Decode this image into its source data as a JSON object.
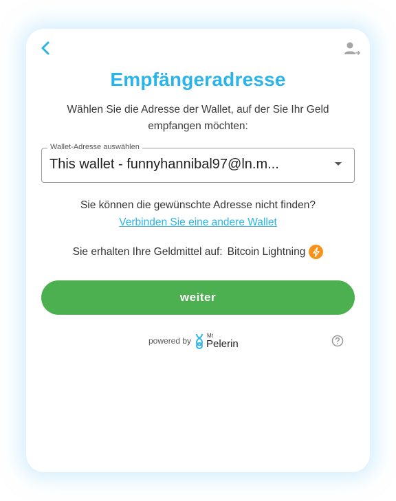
{
  "header": {
    "back_icon": "chevron-left-icon",
    "account_icon": "user-logout-icon"
  },
  "title": "Empfängeradresse",
  "subtitle": "Wählen Sie die Adresse der Wallet, auf der Sie Ihr Geld empfangen möchten:",
  "wallet_select": {
    "legend": "Wallet-Adresse auswählen",
    "value": "This wallet - funnyhannibal97@ln.m..."
  },
  "not_found_text": "Sie können die gewünschte Adresse nicht finden?",
  "connect_link": "Verbinden Sie eine andere Wallet",
  "receive": {
    "label": "Sie erhalten Ihre Geldmittel auf:",
    "network": "Bitcoin Lightning",
    "network_icon": "lightning-icon"
  },
  "continue_label": "weiter",
  "footer": {
    "powered_by": "powered by",
    "brand_prefix": "Mt",
    "brand_name": "Pelerin",
    "help_icon": "help-circle-icon"
  },
  "colors": {
    "accent": "#2ab4e8",
    "button": "#4caf50",
    "lightning": "#f7931a"
  }
}
